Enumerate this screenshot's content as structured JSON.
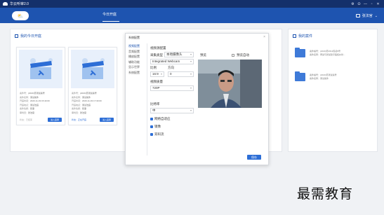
{
  "app": {
    "title": "华云听审2.0"
  },
  "window_controls": [
    "⚙",
    "⭘",
    "—",
    "▫",
    "✕"
  ],
  "nav": {
    "tab": "今日开庭",
    "user": "张法官"
  },
  "left": {
    "title": "我的今日开庭",
    "cards": [
      {
        "lines": [
          {
            "k": "案件号：",
            "v": "(2020)苏测试案号"
          },
          {
            "k": "案件名称：",
            "v": "测试案件"
          },
          {
            "k": "开庭时间：",
            "v": "2020-11-03 15:40:00"
          },
          {
            "k": "开庭地点：",
            "v": "测试法庭"
          },
          {
            "k": "案件性质：",
            "v": "民事"
          },
          {
            "k": "审判员：",
            "v": "张法官"
          }
        ],
        "footer": "状态：已结束",
        "button": "进入庭审"
      },
      {
        "lines": [
          {
            "k": "案件号：",
            "v": "(2020)苏测试案号"
          },
          {
            "k": "案件名称：",
            "v": "测试案件"
          },
          {
            "k": "开庭时间：",
            "v": "2020-11-03 17:30:00"
          },
          {
            "k": "开庭地点：",
            "v": "测试法庭"
          },
          {
            "k": "案件性质：",
            "v": "民事"
          },
          {
            "k": "审判员：",
            "v": "张法官"
          }
        ],
        "footer": "状态：正在开庭",
        "button": "进入庭审"
      }
    ]
  },
  "right": {
    "title": "我的案件",
    "cases": [
      {
        "line1": "案件编号：(2020)苏0612民初6号",
        "line2": "案件名称：黄某与张某建平股权纠纷..."
      },
      {
        "line1": "案件编号：(2020)苏测试案号",
        "line2": "案件名称：测试案件"
      }
    ]
  },
  "modal": {
    "title": "系统配置",
    "close": "×",
    "side": [
      "视频配置",
      "音频配置",
      "播放配置",
      "辅助功能",
      "显示世界",
      "系统配置"
    ],
    "video_heading": "视频源配置",
    "capture_label": "采集类型",
    "capture_value": "本地摄像头",
    "device_value": "Integrated Webcam",
    "ratio_label": "比例",
    "direction_label": "方向",
    "ratio_value": "16:9",
    "direction_value": "0",
    "quality_label": "视频质量",
    "quality_value": "720P",
    "bitrate_label": "比特率",
    "bitrate_value": "中",
    "checks": [
      "网络自适应",
      "镜像",
      "双码流"
    ],
    "preview_label": "预览",
    "preview_toggle": "预览自动",
    "save": "保存"
  },
  "watermark": "最需教育"
}
